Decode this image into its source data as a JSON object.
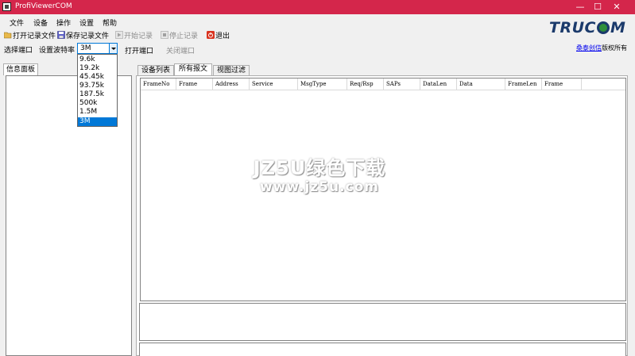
{
  "window": {
    "title": "ProfiViewerCOM",
    "minimize": "—",
    "maximize": "☐",
    "close": "✕"
  },
  "menu": [
    "文件",
    "设备",
    "操作",
    "设置",
    "帮助"
  ],
  "toolbar": {
    "open_record": "打开记录文件",
    "save_record": "保存记录文件",
    "start_record": "开始记录",
    "stop_record": "停止记录",
    "exit": "退出"
  },
  "options": {
    "select_port": "选择端口",
    "set_baud": "设置波特率",
    "baud_value": "3M",
    "open_port": "打开端口",
    "close_port": "关闭端口"
  },
  "baud_options": [
    "9.6k",
    "19.2k",
    "45.45k",
    "93.75k",
    "187.5k",
    "500k",
    "1.5M",
    "3M"
  ],
  "brand": {
    "logo_pre": "TRUC",
    "logo_post": "M",
    "copyright_link": "桑泰创信",
    "copyright_suffix": "版权所有"
  },
  "info_panel": {
    "tab_label": "信息面板"
  },
  "tabs": [
    "设备列表",
    "所有报文",
    "视图过滤"
  ],
  "columns": [
    "FrameNo",
    "Frame",
    "Address",
    "Service",
    "MsgType",
    "Req/Rsp",
    "SAPs",
    "DataLen",
    "Data",
    "FrameLen",
    "Frame"
  ],
  "watermark": {
    "line1": "JZ5U绿色下载",
    "line2": "www.jz5u.com"
  },
  "colors": {
    "titlebar": "#d4264b",
    "selection": "#0078d7",
    "logo": "#1b3a6b"
  }
}
